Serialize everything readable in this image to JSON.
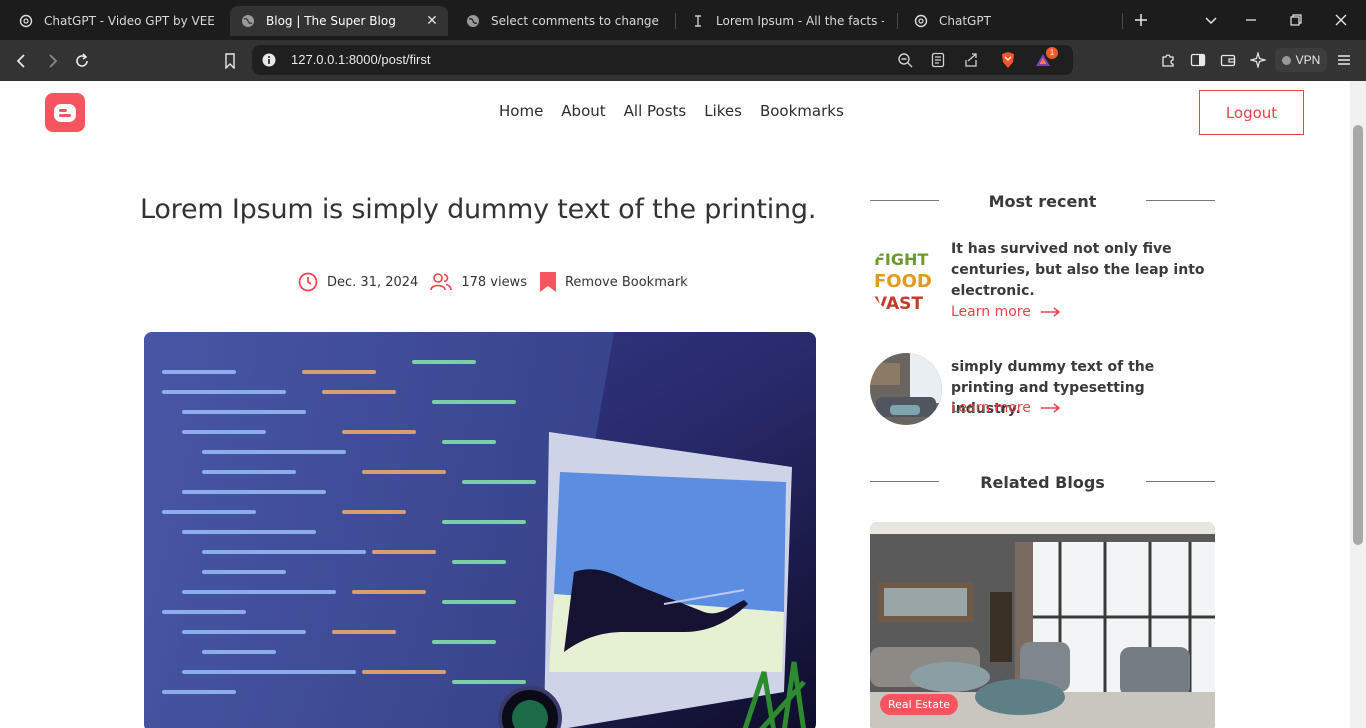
{
  "browser": {
    "tabs": [
      {
        "title": "ChatGPT - Video GPT by VEED",
        "icon": "chatgpt-icon"
      },
      {
        "title": "Blog | The Super Blog",
        "icon": "globe-icon",
        "active": true
      },
      {
        "title": "Select comments to change | Dja",
        "icon": "globe-icon"
      },
      {
        "title": "Lorem Ipsum - All the facts - Lips",
        "icon": "lipsum-icon"
      },
      {
        "title": "ChatGPT",
        "icon": "chatgpt-icon"
      }
    ],
    "url": "127.0.0.1:8000/post/first",
    "notification_count": "1",
    "vpn_label": "VPN"
  },
  "site": {
    "nav": [
      "Home",
      "About",
      "All Posts",
      "Likes",
      "Bookmarks"
    ],
    "logout_label": "Logout"
  },
  "post": {
    "title": "Lorem Ipsum is simply dummy text of the printing.",
    "date": "Dec. 31, 2024",
    "views": "178 views",
    "bookmark_label": "Remove Bookmark"
  },
  "sidebar": {
    "most_recent_heading": "Most recent",
    "recent": [
      {
        "title": "It has survived not only five centuries, but also the leap into electronic.",
        "link": "Learn more"
      },
      {
        "title": "simply dummy text of the printing and typesetting industry.",
        "link": "Learn more"
      }
    ],
    "related_heading": "Related Blogs",
    "related": [
      {
        "category": "Real Estate"
      }
    ]
  },
  "colors": {
    "accent": "#f0414d",
    "logo": "#f6545e",
    "chrome_dark": "#1c1c1c",
    "chrome_bar": "#333333"
  }
}
